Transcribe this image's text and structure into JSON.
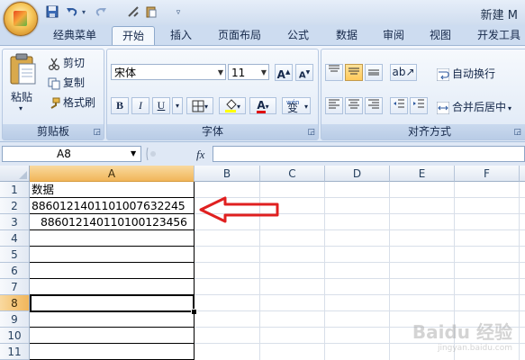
{
  "title": {
    "window_title": "新建 M"
  },
  "quick_access": {
    "save_icon": "save-icon",
    "undo_icon": "undo-icon",
    "redo_icon": "redo-icon",
    "customize_icon": "customize-icon"
  },
  "tabs": [
    {
      "label": "经典菜单"
    },
    {
      "label": "开始"
    },
    {
      "label": "插入"
    },
    {
      "label": "页面布局"
    },
    {
      "label": "公式"
    },
    {
      "label": "数据"
    },
    {
      "label": "审阅"
    },
    {
      "label": "视图"
    },
    {
      "label": "开发工具"
    }
  ],
  "active_tab": "开始",
  "ribbon": {
    "clipboard": {
      "label": "剪贴板",
      "paste": "粘贴",
      "cut": "剪切",
      "copy": "复制",
      "format_painter": "格式刷"
    },
    "font": {
      "label": "字体",
      "font_name": "宋体",
      "font_size": "11",
      "bold": "B",
      "italic": "I",
      "underline": "U",
      "grow": "A",
      "shrink": "A",
      "font_color_letter": "A",
      "phonetic": "变",
      "phonetic_small": "wén"
    },
    "alignment": {
      "label": "对齐方式",
      "wrap_text": "自动换行",
      "merge_center": "合并后居中"
    }
  },
  "formula_bar": {
    "name_box": "A8",
    "fx": "fx",
    "formula": ""
  },
  "sheet": {
    "columns": [
      "A",
      "B",
      "C",
      "D",
      "E",
      "F"
    ],
    "rows": [
      "1",
      "2",
      "3",
      "4",
      "5",
      "6",
      "7",
      "8",
      "9",
      "10",
      "11"
    ],
    "selected_column": "A",
    "selected_row": "8",
    "cells_A": [
      "数据",
      "886012140110100763224​5",
      "88601214011010012345​6",
      "",
      "",
      "",
      "",
      "",
      "",
      "",
      ""
    ]
  },
  "annotation": {
    "arrow_color": "#e02020"
  },
  "watermark": {
    "text": "Baidu 经验",
    "sub": "jingyan.baidu.com"
  }
}
